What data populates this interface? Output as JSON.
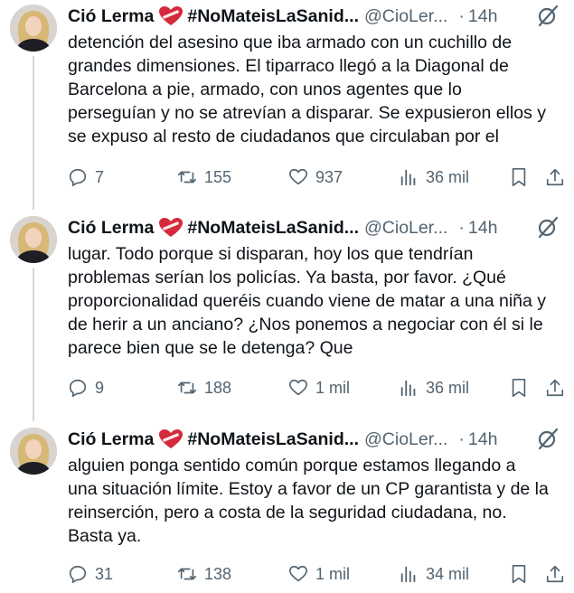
{
  "tweets": [
    {
      "author": "Ció Lerma",
      "hashtag": "#NoMateisLaSanid...",
      "handle": "@CioLer...",
      "separator": "·",
      "time": "14h",
      "lines": [
        "detención del asesino que iba armado con un cuchillo de",
        "grandes dimensiones. El tiparraco llegó a la Diagonal de",
        "Barcelona a pie, armado, con unos agentes que lo",
        "perseguían y no se atrevían a disparar. Se expusieron ellos y",
        "se expuso al resto de ciudadanos que circulaban por el"
      ],
      "replies": "7",
      "reposts": "155",
      "likes": "937",
      "views": "36 mil"
    },
    {
      "author": "Ció Lerma",
      "hashtag": "#NoMateisLaSanid...",
      "handle": "@CioLer...",
      "separator": "·",
      "time": "14h",
      "lines": [
        "lugar. Todo porque si disparan, hoy los que tendrían",
        "problemas serían los policías. Ya basta, por favor. ¿Qué",
        "proporcionalidad queréis cuando viene de matar a una niña y",
        "de herir a un anciano? ¿Nos ponemos a negociar con él si le",
        "parece bien que se le detenga? Que"
      ],
      "replies": "9",
      "reposts": "188",
      "likes": "1 mil",
      "views": "36 mil"
    },
    {
      "author": "Ció Lerma",
      "hashtag": "#NoMateisLaSanid...",
      "handle": "@CioLer...",
      "separator": "·",
      "time": "14h",
      "lines": [
        "alguien ponga sentido común porque estamos llegando a",
        "una situación límite. Estoy a favor de un CP garantista y de la",
        "reinserción, pero a costa de la seguridad ciudadana, no.",
        "Basta ya."
      ],
      "replies": "31",
      "reposts": "138",
      "likes": "1 mil",
      "views": "34 mil"
    }
  ],
  "icons": {
    "reply": "reply-icon",
    "repost": "repost-icon",
    "like": "like-icon",
    "views": "views-icon",
    "bookmark": "bookmark-icon",
    "share": "share-icon",
    "grok": "grok-icon",
    "heart_emoji": "heart-ribbon-icon"
  },
  "colors": {
    "text": "#0f1419",
    "secondary": "#536471",
    "thread_line": "#cfd9de",
    "heart": "#d42a3c"
  }
}
